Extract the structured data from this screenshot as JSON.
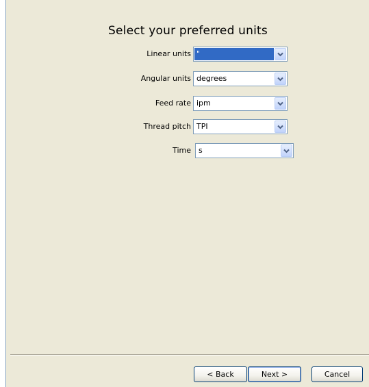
{
  "wizard": {
    "title": "Select your preferred units",
    "fields": [
      {
        "label": "Linear units",
        "value": "\"",
        "selected": true
      },
      {
        "label": "Angular units",
        "value": "degrees",
        "selected": false
      },
      {
        "label": "Feed rate",
        "value": "ipm",
        "selected": false
      },
      {
        "label": "Thread pitch",
        "value": "TPI",
        "selected": false
      },
      {
        "label": "Time",
        "value": "s",
        "selected": false
      }
    ],
    "buttons": {
      "back": "< Back",
      "next": "Next >",
      "cancel": "Cancel"
    }
  },
  "colors": {
    "dialog_bg": "#ece9d8",
    "selection": "#316ac5",
    "field_border": "#7f9db9"
  }
}
